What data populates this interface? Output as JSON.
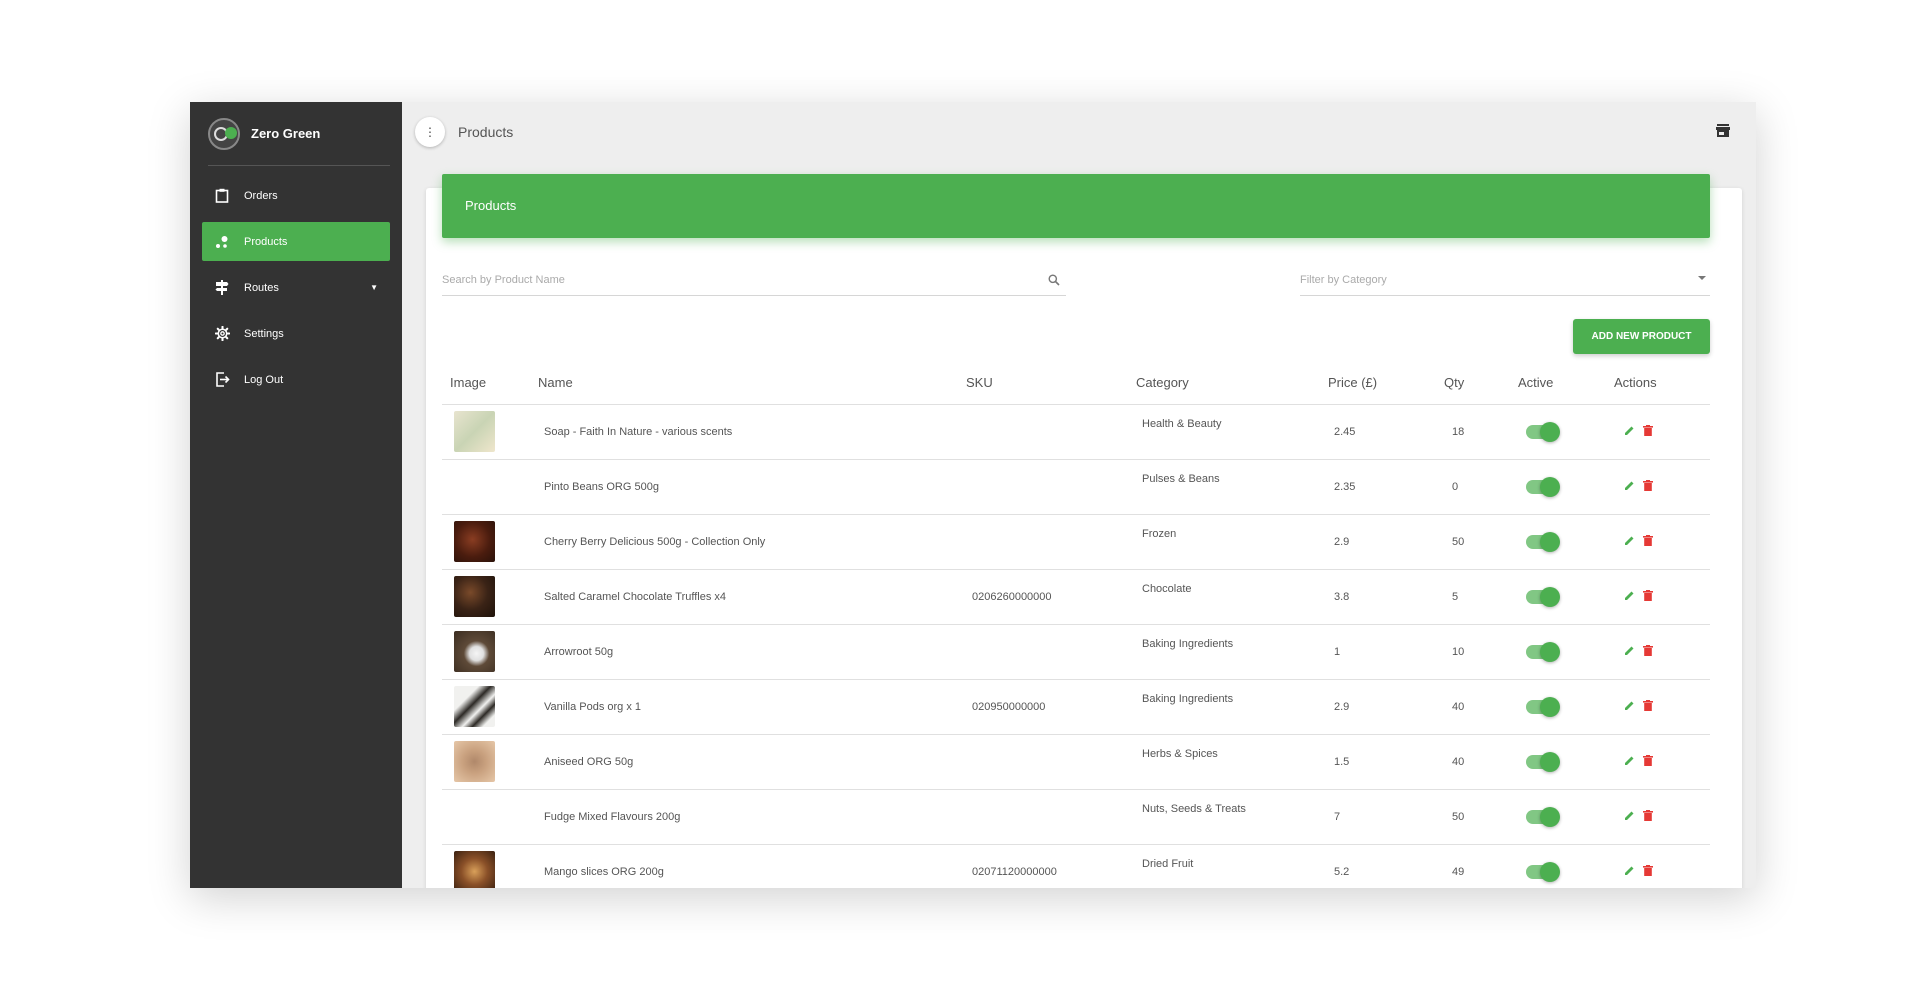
{
  "sidebar": {
    "brand": "Zero Green",
    "items": [
      {
        "label": "Orders",
        "icon": "clipboard-icon"
      },
      {
        "label": "Products",
        "icon": "scatter-icon",
        "active": true
      },
      {
        "label": "Routes",
        "icon": "signpost-icon"
      },
      {
        "label": "Settings",
        "icon": "gear-icon"
      },
      {
        "label": "Log Out",
        "icon": "logout-icon"
      }
    ]
  },
  "topbar": {
    "title": "Products"
  },
  "card": {
    "header": "Products",
    "search_placeholder": "Search by Product Name",
    "filter_placeholder": "Filter by Category",
    "add_button": "ADD NEW PRODUCT"
  },
  "table": {
    "columns": [
      "Image",
      "Name",
      "SKU",
      "Category",
      "Price (£)",
      "Qty",
      "Active",
      "Actions"
    ],
    "rows": [
      {
        "name": "Soap - Faith In Nature - various scents",
        "sku": "",
        "category": "Health & Beauty",
        "price": "2.45",
        "qty": "18",
        "image": "soap",
        "active": true
      },
      {
        "name": "Pinto Beans ORG 500g",
        "sku": "",
        "category": "Pulses & Beans",
        "price": "2.35",
        "qty": "0",
        "image": "",
        "active": true
      },
      {
        "name": "Cherry Berry Delicious 500g - Collection Only",
        "sku": "",
        "category": "Frozen",
        "price": "2.9",
        "qty": "50",
        "image": "cherry",
        "active": true
      },
      {
        "name": "Salted Caramel Chocolate Truffles x4",
        "sku": "0206260000000",
        "category": "Chocolate",
        "price": "3.8",
        "qty": "5",
        "image": "truffles",
        "active": true
      },
      {
        "name": "Arrowroot 50g",
        "sku": "",
        "category": "Baking Ingredients",
        "price": "1",
        "qty": "10",
        "image": "arrowroot",
        "active": true
      },
      {
        "name": "Vanilla Pods org x 1",
        "sku": "020950000000",
        "category": "Baking Ingredients",
        "price": "2.9",
        "qty": "40",
        "image": "vanilla",
        "active": true
      },
      {
        "name": "Aniseed ORG 50g",
        "sku": "",
        "category": "Herbs & Spices",
        "price": "1.5",
        "qty": "40",
        "image": "aniseed",
        "active": true
      },
      {
        "name": "Fudge Mixed Flavours 200g",
        "sku": "",
        "category": "Nuts, Seeds & Treats",
        "price": "7",
        "qty": "50",
        "image": "",
        "active": true
      },
      {
        "name": "Mango slices ORG 200g",
        "sku": "02071120000000",
        "category": "Dried Fruit",
        "price": "5.2",
        "qty": "49",
        "image": "mango",
        "active": true
      }
    ]
  },
  "colors": {
    "accent": "#4caf50",
    "sidebar": "#333333",
    "delete": "#e53935"
  }
}
